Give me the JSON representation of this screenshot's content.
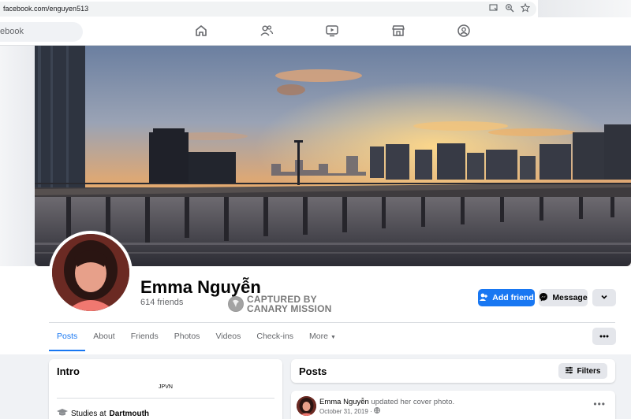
{
  "browser": {
    "url": "facebook.com/enguyen513"
  },
  "search": {
    "text": "ebook"
  },
  "nav": {
    "icons": [
      "home-icon",
      "friends-icon",
      "watch-icon",
      "marketplace-icon",
      "groups-icon"
    ]
  },
  "profile": {
    "name": "Emma Nguyễn",
    "friends": "614 friends"
  },
  "watermark": {
    "line1": "CAPTURED BY",
    "line2": "CANARY MISSION"
  },
  "actions": {
    "add_friend": "Add friend",
    "message": "Message"
  },
  "tabs": [
    "Posts",
    "About",
    "Friends",
    "Photos",
    "Videos",
    "Check-ins",
    "More"
  ],
  "intro": {
    "title": "Intro",
    "bio": "JPVN",
    "education_prefix": "Studies at",
    "education_school": "Dartmouth"
  },
  "posts": {
    "title": "Posts",
    "filters": "Filters",
    "first_post": {
      "author": "Emma Nguyễn",
      "action": "updated her cover photo.",
      "date": "October 31, 2019",
      "separator": "·"
    }
  },
  "colors": {
    "brand_blue": "#1877f2",
    "button_gray": "#e4e6eb",
    "page_bg": "#f0f2f5"
  }
}
